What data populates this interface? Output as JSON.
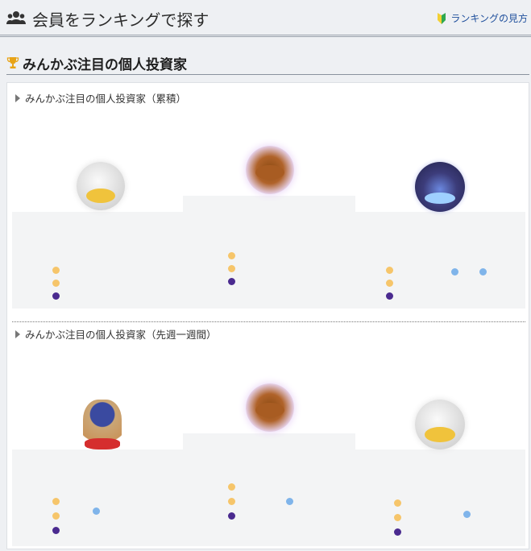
{
  "header": {
    "title": "会員をランキングで探す",
    "help_label": "ランキングの見方",
    "users_icon": "users-icon",
    "help_icon": "beginner-leaf-icon"
  },
  "section": {
    "title": "みんかぶ注目の個人投資家",
    "icon": "trophy-icon"
  },
  "rankings": [
    {
      "label": "みんかぶ注目の個人投資家（累積）"
    },
    {
      "label": "みんかぶ注目の個人投資家（先週一週間）"
    }
  ],
  "colors": {
    "link": "#1f4f9c",
    "trophy": "#e8a417",
    "leaf_green": "#2fa84f",
    "leaf_yellow": "#f3d034"
  }
}
